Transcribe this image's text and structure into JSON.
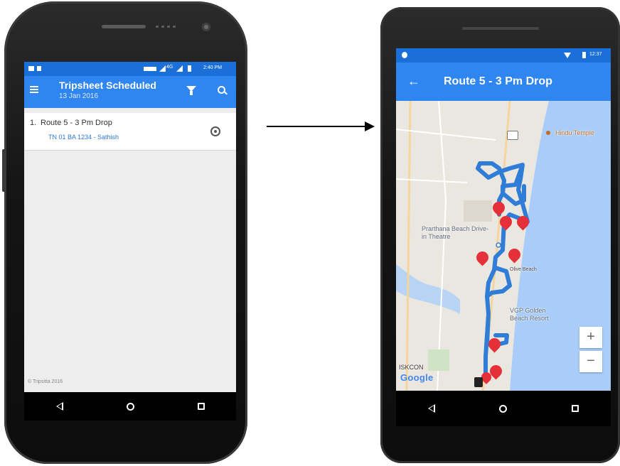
{
  "left_screen": {
    "status_time": "2:40 PM",
    "status_network": "4G",
    "title": "Tripsheet Scheduled",
    "subtitle": "13 Jan 2016",
    "menu_icon": "hamburger-menu-icon",
    "filter_icon": "filter-icon",
    "search_icon": "search-icon",
    "items": [
      {
        "number": "1.",
        "title": "Route 5 - 3 Pm Drop",
        "subtitle": "TN 01 BA 1234 - Sathish",
        "action_icon": "locate-icon"
      }
    ],
    "footer": "© Tripsitta 2016"
  },
  "right_screen": {
    "status_time": "12:37",
    "title": "Route 5 - 3 Pm Drop",
    "back_icon": "arrow-back-icon",
    "map": {
      "labels": [
        "Hindu Temple",
        "Prarthana Beach Drive-in Theatre",
        "Olive Beach",
        "VGP Golden Beach Resort",
        "ISKCON",
        "Google"
      ],
      "zoom_in_label": "+",
      "zoom_out_label": "−",
      "stop_count": 9
    }
  },
  "colors": {
    "app_bar_blue": "#2f86f0",
    "status_blue": "#1b6fd8",
    "route_blue": "#2f7dd6",
    "marker_red": "#e5303a",
    "map_land": "#eae7e0",
    "map_sea": "#a9cdf8"
  }
}
